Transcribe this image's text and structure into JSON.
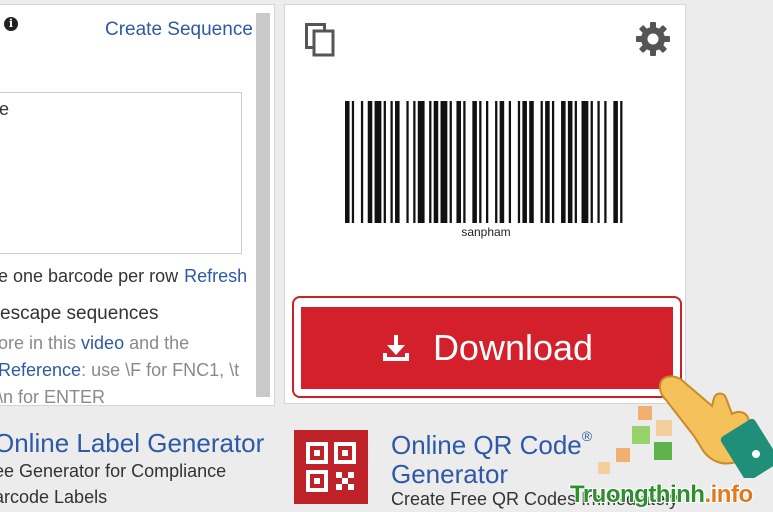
{
  "left_panel": {
    "create_sequence": "Create Sequence",
    "info_symbol": "i",
    "textarea_value": "e",
    "row_text": "e one barcode per row",
    "refresh": "Refresh",
    "escape_text": "escape sequences",
    "help_line1_prefix": "ore in this ",
    "help_line1_link": "video",
    "help_line1_suffix": " and the",
    "help_line2_link": "Reference",
    "help_line2_suffix": ": use \\F for FNC1, \\t",
    "help_line3": "\\n for ENTER"
  },
  "right_panel": {
    "barcode_text": "sanpham",
    "download_label": "Download",
    "icons": [
      "copy-icon",
      "gear-icon",
      "download-icon"
    ]
  },
  "bottom": {
    "label_generator": {
      "title": "Online Label Generator",
      "desc_line1": "ee Generator for Compliance",
      "desc_line2": "arcode Labels"
    },
    "qr_generator": {
      "title_line1": "Online QR Code",
      "registered": "®",
      "title_line2": "Generator",
      "desc": "Create Free QR Codes Immediately"
    }
  },
  "watermark": {
    "prefix": "Truongthinh",
    "suffix": ".info"
  },
  "colors": {
    "accent_blue": "#2e59a6",
    "download_red": "#d3202a",
    "qr_red": "#bf2129",
    "watermark_green": "#2d8f2d"
  }
}
